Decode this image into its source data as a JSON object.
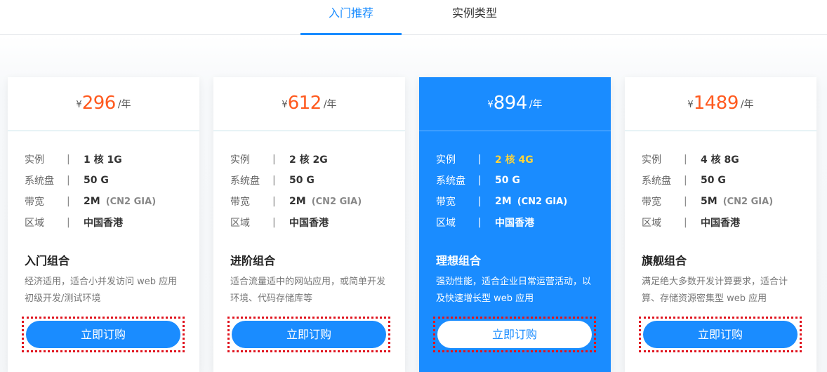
{
  "tabs": [
    {
      "label": "入门推荐",
      "active": true
    },
    {
      "label": "实例类型",
      "active": false
    }
  ],
  "colors": {
    "accent": "#1a8cff",
    "price": "#ff5a1f",
    "highlight": "#ffd43b"
  },
  "spec_labels": {
    "instance": "实例",
    "disk": "系统盘",
    "bandwidth": "带宽",
    "region": "区域",
    "separator": "|"
  },
  "currency": "¥",
  "period": "/年",
  "cards": [
    {
      "price": "296",
      "instance": "1 核 1G",
      "disk": "50 G",
      "bandwidth": "2M",
      "bandwidth_note": "(CN2 GIA)",
      "region": "中国香港",
      "title": "入门组合",
      "desc": "经济适用，适合小并发访问 web 应用初级开发/测试环境",
      "button": "立即订购"
    },
    {
      "price": "612",
      "instance": "2 核 2G",
      "disk": "50 G",
      "bandwidth": "2M",
      "bandwidth_note": "(CN2 GIA)",
      "region": "中国香港",
      "title": "进阶组合",
      "desc": "适合流量适中的网站应用，或简单开发环境、代码存储库等",
      "button": "立即订购"
    },
    {
      "price": "894",
      "instance": "2 核 4G",
      "disk": "50 G",
      "bandwidth": "2M",
      "bandwidth_note": "(CN2 GIA)",
      "region": "中国香港",
      "title": "理想组合",
      "desc": "强劲性能，适合企业日常运营活动，以及快速增长型 web 应用",
      "button": "立即订购",
      "featured": true
    },
    {
      "price": "1489",
      "instance": "4 核 8G",
      "disk": "50 G",
      "bandwidth": "5M",
      "bandwidth_note": "(CN2 GIA)",
      "region": "中国香港",
      "title": "旗舰组合",
      "desc": "满足绝大多数开发计算要求，适合计算、存储资源密集型 web 应用",
      "button": "立即订购"
    }
  ]
}
